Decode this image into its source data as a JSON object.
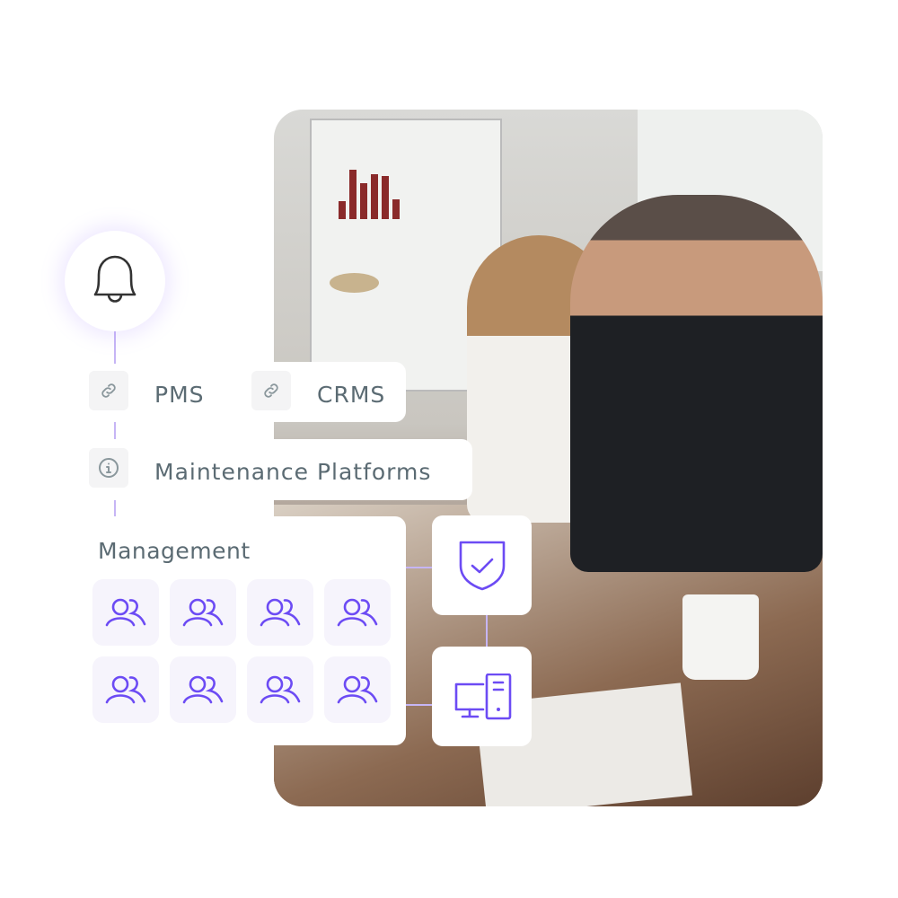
{
  "photo": {
    "description_icon": "team-meeting-photo"
  },
  "notification": {
    "icon": "bell-icon"
  },
  "integrations": [
    {
      "label": "PMS",
      "icon": "link-icon"
    },
    {
      "label": "CRMS",
      "icon": "link-icon"
    },
    {
      "label": "Maintenance Platforms",
      "icon": "info-icon"
    }
  ],
  "management": {
    "title": "Management",
    "tile_icon": "users-icon",
    "tile_count": 8
  },
  "features": [
    {
      "icon": "shield-check-icon"
    },
    {
      "icon": "computer-icon"
    }
  ],
  "colors": {
    "accent": "#6c4bf4",
    "text": "#5b6b73",
    "connector": "#c6b5f5",
    "tile_bg": "#f6f4fc"
  }
}
